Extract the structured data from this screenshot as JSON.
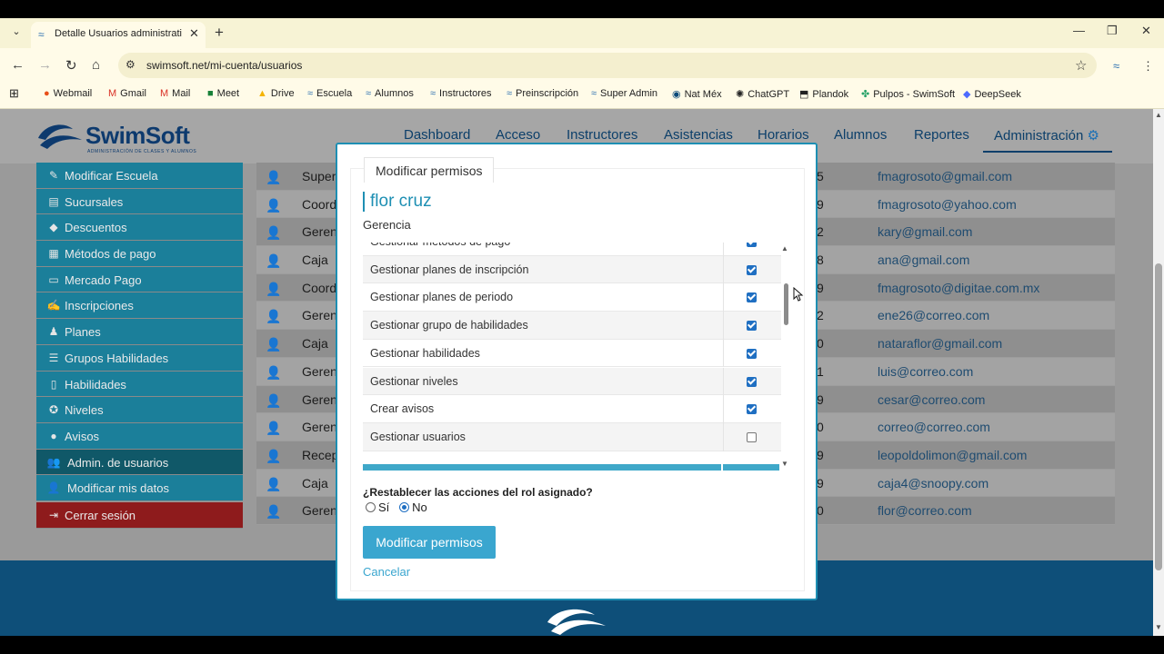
{
  "browser": {
    "tab_title": "Detalle Usuarios administrativo",
    "url": "swimsoft.net/mi-cuenta/usuarios",
    "bookmarks": [
      {
        "label": "Webmail",
        "icon": "webmail-icon"
      },
      {
        "label": "Gmail",
        "icon": "gmail-icon"
      },
      {
        "label": "Mail",
        "icon": "mail-icon"
      },
      {
        "label": "Meet",
        "icon": "meet-icon"
      },
      {
        "label": "Drive",
        "icon": "drive-icon"
      },
      {
        "label": "Escuela",
        "icon": "swimsoft-icon"
      },
      {
        "label": "Alumnos",
        "icon": "swimsoft-icon"
      },
      {
        "label": "Instructores",
        "icon": "swimsoft-icon"
      },
      {
        "label": "Preinscripción",
        "icon": "swimsoft-icon"
      },
      {
        "label": "Super Admin",
        "icon": "swimsoft-icon"
      },
      {
        "label": "Nat Méx",
        "icon": "globe-icon"
      },
      {
        "label": "ChatGPT",
        "icon": "chatgpt-icon"
      },
      {
        "label": "Plandok",
        "icon": "plandok-icon"
      },
      {
        "label": "Pulpos - SwimSoft",
        "icon": "pulpos-icon"
      },
      {
        "label": "DeepSeek",
        "icon": "deepseek-icon"
      }
    ]
  },
  "header": {
    "brand": "SwimSoft",
    "brand_sub": "ADMINISTRACIÓN DE CLASES Y ALUMNOS",
    "nav": [
      "Dashboard",
      "Acceso",
      "Instructores",
      "Asistencias",
      "Horarios",
      "Alumnos",
      "Reportes",
      "Administración"
    ]
  },
  "sidebar": {
    "items": [
      {
        "label": "Modificar Escuela",
        "icon": "edit-icon"
      },
      {
        "label": "Sucursales",
        "icon": "store-icon"
      },
      {
        "label": "Descuentos",
        "icon": "tag-icon"
      },
      {
        "label": "Métodos de pago",
        "icon": "money-icon"
      },
      {
        "label": "Mercado Pago",
        "icon": "card-icon"
      },
      {
        "label": "Inscripciones",
        "icon": "signup-icon"
      },
      {
        "label": "Planes",
        "icon": "plan-icon"
      },
      {
        "label": "Grupos Habilidades",
        "icon": "list-icon"
      },
      {
        "label": "Habilidades",
        "icon": "doc-icon"
      },
      {
        "label": "Niveles",
        "icon": "level-icon"
      },
      {
        "label": "Avisos",
        "icon": "chat-icon"
      },
      {
        "label": "Admin. de usuarios",
        "icon": "users-icon"
      },
      {
        "label": "Modificar mis datos",
        "icon": "user-edit-icon"
      }
    ],
    "logout": "Cerrar sesión"
  },
  "table": {
    "rows": [
      {
        "role": "Super",
        "num": "5",
        "email": "fmagrosoto@gmail.com"
      },
      {
        "role": "Coord",
        "num": "9",
        "email": "fmagrosoto@yahoo.com"
      },
      {
        "role": "Geren",
        "num": "2",
        "email": "kary@gmail.com"
      },
      {
        "role": "Caja",
        "num": "8",
        "email": "ana@gmail.com"
      },
      {
        "role": "Coord",
        "num": "9",
        "email": "fmagrosoto@digitae.com.mx"
      },
      {
        "role": "Geren",
        "num": "2",
        "email": "ene26@correo.com"
      },
      {
        "role": "Caja",
        "num": "0",
        "email": "nataraflor@gmail.com"
      },
      {
        "role": "Geren",
        "num": "1",
        "email": "luis@correo.com"
      },
      {
        "role": "Geren",
        "num": "9",
        "email": "cesar@correo.com"
      },
      {
        "role": "Geren",
        "num": "0",
        "email": "correo@correo.com"
      },
      {
        "role": "Recep",
        "num": "9",
        "email": "leopoldolimon@gmail.com"
      },
      {
        "role": "Caja",
        "num": "9",
        "email": "caja4@snoopy.com"
      },
      {
        "role": "Geren",
        "num": "0",
        "email": "flor@correo.com"
      }
    ]
  },
  "modal": {
    "tab_label": "Modificar permisos",
    "user_name": "flor cruz",
    "user_role": "Gerencia",
    "permissions": [
      {
        "label": "Gestionar métodos de pago",
        "checked": true
      },
      {
        "label": "Gestionar planes de inscripción",
        "checked": true
      },
      {
        "label": "Gestionar planes de periodo",
        "checked": true
      },
      {
        "label": "Gestionar grupo de habilidades",
        "checked": true
      },
      {
        "label": "Gestionar habilidades",
        "checked": true
      },
      {
        "label": "Gestionar niveles",
        "checked": true
      },
      {
        "label": "Crear avisos",
        "checked": true
      },
      {
        "label": "Gestionar usuarios",
        "checked": false
      }
    ],
    "question": "¿Restablecer las acciones del rol asignado?",
    "option_yes": "Sí",
    "option_no": "No",
    "selected": "No",
    "submit_label": "Modificar permisos",
    "cancel_label": "Cancelar"
  },
  "colors": {
    "accent": "#3aa6cf",
    "sidebar": "#1b7f9a",
    "logout": "#8e1b1c",
    "footer": "#0e4f79",
    "brand": "#0d3a6e"
  }
}
